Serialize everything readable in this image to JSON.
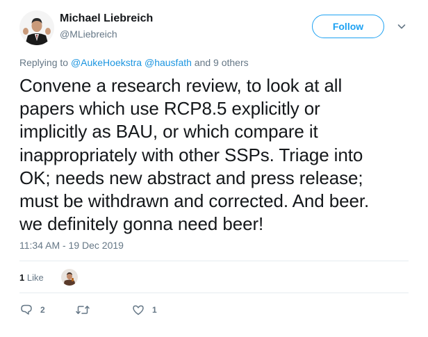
{
  "author": {
    "name": "Michael Liebreich",
    "handle": "@MLiebreich"
  },
  "follow_label": "Follow",
  "reply_context": {
    "prefix": "Replying to",
    "mention_1": "@AukeHoekstra",
    "mention_2": "@hausfath",
    "suffix": "and 9 others"
  },
  "tweet_lines": [
    "Convene a research review, to look at all",
    "papers which use RCP8.5 explicitly or",
    "implicitly as BAU, or which compare it",
    "inappropriately with other SSPs. Triage into",
    "OK; needs new abstract and press release;",
    "must be withdrawn and corrected. And beer.",
    "we definitely gonna need beer!"
  ],
  "timestamp": "11:34 AM - 19 Dec 2019",
  "engagement": {
    "likes_count": "1",
    "likes_label": "Like"
  },
  "actions": {
    "reply_count": "2",
    "retweet_count": "",
    "like_count": "1"
  },
  "icons": {
    "reply": "reply-icon",
    "retweet": "retweet-icon",
    "like": "heart-icon",
    "more": "chevron-down-icon"
  },
  "colors": {
    "accent": "#1da1f2",
    "link": "#1b95e0",
    "secondary_text": "#657786",
    "text": "#14171a",
    "divider": "#e6ecf0"
  }
}
